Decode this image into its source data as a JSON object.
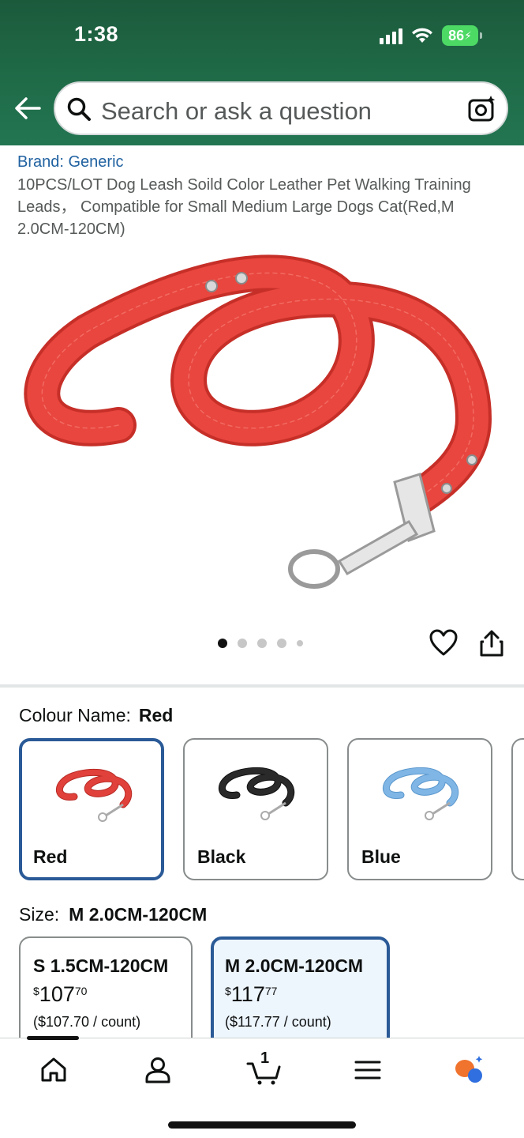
{
  "status_bar": {
    "time": "1:38",
    "battery": "86"
  },
  "header": {
    "search_placeholder": "Search or ask a question",
    "back_icon": "back-arrow-icon",
    "camera_icon": "camera-search-icon"
  },
  "product": {
    "brand": "Brand: Generic",
    "title": "10PCS/LOT Dog Leash Soild Color Leather Pet Walking Training Leads， Compatible for Small Medium Large Dogs Cat(Red,M 2.0CM-120CM)",
    "image_count": 5,
    "image_index": 1
  },
  "colour": {
    "label": "Colour Name:",
    "selected": "Red",
    "options": [
      {
        "label": "Red",
        "color": "#e0413a",
        "dark": "#b82a25"
      },
      {
        "label": "Black",
        "color": "#2a2a2a",
        "dark": "#111111"
      },
      {
        "label": "Blue",
        "color": "#7fb6e6",
        "dark": "#5b97cc"
      }
    ]
  },
  "size": {
    "label": "Size:",
    "selected": "M 2.0CM-120CM",
    "options": [
      {
        "name": "S 1.5CM-120CM",
        "currency": "$",
        "whole": "107",
        "fraction": "70",
        "unit_price": "($107.70 / count)"
      },
      {
        "name": "M 2.0CM-120CM",
        "currency": "$",
        "whole": "117",
        "fraction": "77",
        "unit_price": "($117.77 / count)"
      }
    ]
  },
  "bottom_nav": {
    "items": [
      "home-icon",
      "account-icon",
      "cart-icon",
      "menu-icon",
      "rufus-ai-icon"
    ],
    "cart_count": "1"
  },
  "colors": {
    "header_green": "#1f6b48",
    "selected_border": "#2a5a97",
    "link_blue": "#2162a1"
  }
}
